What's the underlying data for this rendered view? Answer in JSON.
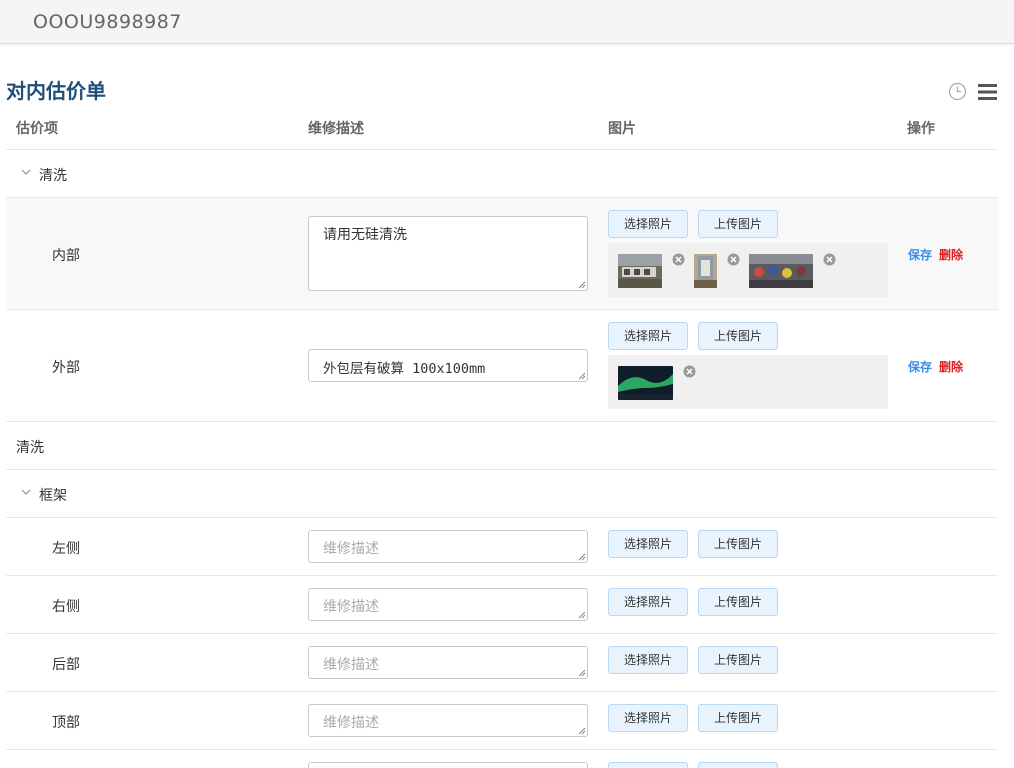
{
  "header": {
    "code": "OOOU9898987"
  },
  "page": {
    "title": "对内估价单"
  },
  "table": {
    "columns": [
      "估价项",
      "维修描述",
      "图片",
      "操作"
    ],
    "buttons": {
      "choose": "选择照片",
      "upload": "上传图片",
      "save": "保存",
      "delete": "删除"
    },
    "placeholder": "维修描述",
    "groups": [
      {
        "label": "清洗",
        "items": [
          {
            "label": "内部",
            "description": "请用无硅清洗"
          },
          {
            "label": "外部",
            "description": "外包层有破算 100x100mm"
          }
        ]
      },
      {
        "label": "清洗"
      },
      {
        "label": "框架",
        "items": [
          {
            "label": "左侧",
            "description": ""
          },
          {
            "label": "右侧",
            "description": ""
          },
          {
            "label": "后部",
            "description": ""
          },
          {
            "label": "顶部",
            "description": ""
          }
        ]
      }
    ]
  },
  "colors": {
    "accent": "#3a8ee6",
    "danger": "#e02020",
    "title": "#1f4e79"
  }
}
